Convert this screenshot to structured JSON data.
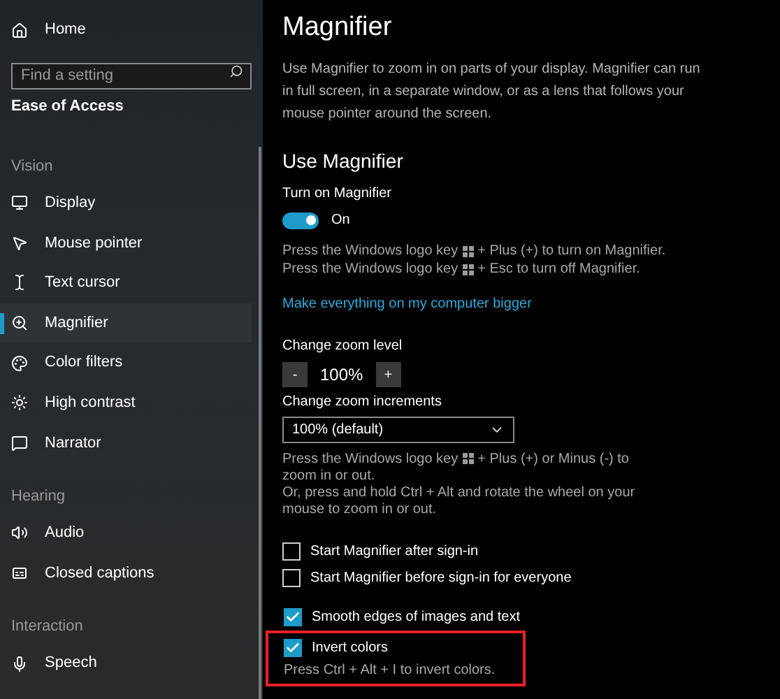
{
  "sidebar": {
    "home": "Home",
    "search": {
      "placeholder": "Find a setting"
    },
    "category": "Ease of Access",
    "groups": [
      {
        "heading": "Vision",
        "items": [
          {
            "label": "Display",
            "selected": false
          },
          {
            "label": "Mouse pointer",
            "selected": false
          },
          {
            "label": "Text cursor",
            "selected": false
          },
          {
            "label": "Magnifier",
            "selected": true
          },
          {
            "label": "Color filters",
            "selected": false
          },
          {
            "label": "High contrast",
            "selected": false
          },
          {
            "label": "Narrator",
            "selected": false
          }
        ]
      },
      {
        "heading": "Hearing",
        "items": [
          {
            "label": "Audio",
            "selected": false
          },
          {
            "label": "Closed captions",
            "selected": false
          }
        ]
      },
      {
        "heading": "Interaction",
        "items": [
          {
            "label": "Speech",
            "selected": false
          }
        ]
      }
    ]
  },
  "main": {
    "title": "Magnifier",
    "description": "Use Magnifier to zoom in on parts of your display. Magnifier can run in full screen, in a separate window, or as a lens that follows your mouse pointer around the screen.",
    "section": "Use Magnifier",
    "toggle": {
      "label": "Turn on Magnifier",
      "on": true,
      "state_text": "On"
    },
    "shortcut_hints": [
      {
        "before": "Press the Windows logo key",
        "after": "+ Plus (+) to turn on Magnifier."
      },
      {
        "before": "Press the Windows logo key",
        "after": "+ Esc to turn off Magnifier."
      }
    ],
    "link": "Make everything on my computer bigger",
    "zoom_level": {
      "label": "Change zoom level",
      "minus": "-",
      "value": "100%",
      "plus": "+"
    },
    "zoom_increments": {
      "label": "Change zoom increments",
      "value": "100% (default)"
    },
    "zoom_hint": {
      "before": "Press the Windows logo key",
      "after": "+ Plus (+) or Minus (-) to zoom in or out.",
      "extra": "Or, press and hold Ctrl + Alt and rotate the wheel on your mouse to zoom in or out."
    },
    "startup_checkboxes": [
      {
        "label": "Start Magnifier after sign-in",
        "checked": false
      },
      {
        "label": "Start Magnifier before sign-in for everyone",
        "checked": false
      }
    ],
    "view_checkboxes": [
      {
        "label": "Smooth edges of images and text",
        "checked": true,
        "highlighted": false
      },
      {
        "label": "Invert colors",
        "checked": true,
        "highlighted": true,
        "hint": "Press Ctrl + Alt + I to invert colors."
      }
    ]
  }
}
